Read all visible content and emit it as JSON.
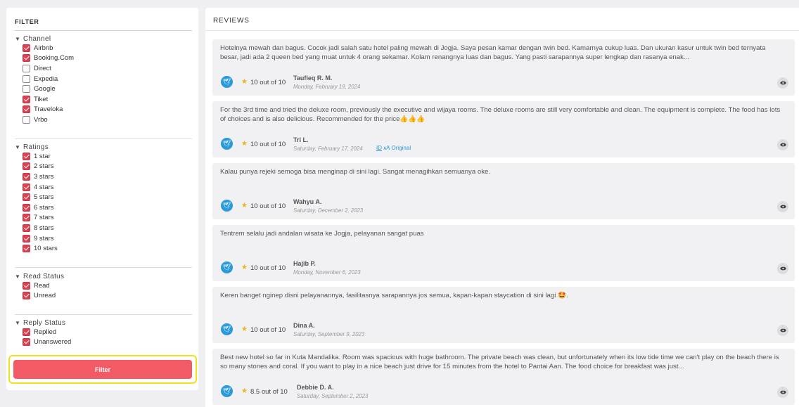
{
  "filter": {
    "title": "FILTER",
    "button_label": "Filter",
    "groups": [
      {
        "label": "Channel",
        "options": [
          {
            "label": "Airbnb",
            "checked": true
          },
          {
            "label": "Booking.Com",
            "checked": true
          },
          {
            "label": "Direct",
            "checked": false
          },
          {
            "label": "Expedia",
            "checked": false
          },
          {
            "label": "Google",
            "checked": false
          },
          {
            "label": "Tiket",
            "checked": true
          },
          {
            "label": "Traveloka",
            "checked": true
          },
          {
            "label": "Vrbo",
            "checked": false
          }
        ]
      },
      {
        "label": "Ratings",
        "options": [
          {
            "label": "1 star",
            "checked": true
          },
          {
            "label": "2 stars",
            "checked": true
          },
          {
            "label": "3 stars",
            "checked": true
          },
          {
            "label": "4 stars",
            "checked": true
          },
          {
            "label": "5 stars",
            "checked": true
          },
          {
            "label": "6 stars",
            "checked": true
          },
          {
            "label": "7 stars",
            "checked": true
          },
          {
            "label": "8 stars",
            "checked": true
          },
          {
            "label": "9 stars",
            "checked": true
          },
          {
            "label": "10 stars",
            "checked": true
          }
        ]
      },
      {
        "label": "Read Status",
        "options": [
          {
            "label": "Read",
            "checked": true
          },
          {
            "label": "Unread",
            "checked": true
          }
        ]
      },
      {
        "label": "Reply Status",
        "options": [
          {
            "label": "Replied",
            "checked": true
          },
          {
            "label": "Unanswered",
            "checked": true
          }
        ]
      }
    ]
  },
  "reviews": {
    "title": "REVIEWS",
    "items": [
      {
        "text": "Hotelnya mewah dan bagus. Cocok jadi salah satu hotel paling mewah di Jogja. Saya pesan kamar dengan twin bed. Kamarnya cukup luas. Dan ukuran kasur untuk twin bed ternyata besar, jadi ada 2 queen bed yang muat untuk 4 orang sekamar. Kolam renangnya luas dan bagus. Yang pasti sarapannya super lengkap dan rasanya enak...",
        "rating": "10 out of 10",
        "reviewer": "Taufieq R. M.",
        "date": "Monday, February 19, 2024",
        "source_icon": "bird-icon"
      },
      {
        "text": "For the 3rd time and tried the deluxe room, previously the executive and wijaya rooms. The deluxe rooms are still very comfortable and clean. The equipment is complete. The food has lots of choices and is also delicious. Recommended for the price👍👍👍",
        "rating": "10 out of 10",
        "reviewer": "Tri L.",
        "date": "Saturday, February 17, 2024",
        "lang_code": "ID",
        "lang_label": "Original",
        "source_icon": "bird-icon"
      },
      {
        "text": "Kalau punya rejeki semoga bisa menginap di sini lagi. Sangat menagihkan semuanya oke.",
        "rating": "10 out of 10",
        "reviewer": "Wahyu A.",
        "date": "Saturday, December 2, 2023",
        "source_icon": "bird-icon"
      },
      {
        "text": "Tentrem selalu jadi andalan wisata ke Jogja, pelayanan sangat puas",
        "rating": "10 out of 10",
        "reviewer": "Hajib P.",
        "date": "Monday, November 6, 2023",
        "source_icon": "bird-icon"
      },
      {
        "text": "Keren banget nginep disni pelayanannya, fasilitasnya sarapannya jos semua, kapan-kapan staycation di sini lagi 🤩.",
        "rating": "10 out of 10",
        "reviewer": "Dina A.",
        "date": "Saturday, September 9, 2023",
        "source_icon": "bird-icon"
      },
      {
        "text": "Best new hotel so far in Kuta Mandalika. Room was spacious with huge bathroom. The private beach was clean, but unfortunately when its low tide time we can't play on the beach there is so many stones and coral. If you want to play in a nice beach just drive for 15 minutes from the hotel to Pantai Aan. The food choice for breakfast was just...",
        "rating": "8.5 out of 10",
        "reviewer": "Debbie D. A.",
        "date": "Saturday, September 2, 2023",
        "source_icon": "bird-icon"
      }
    ]
  },
  "colors": {
    "accent": "#f25a66",
    "checkbox": "#d94454",
    "source_icon": "#2a9ad9",
    "star": "#f2b01e",
    "focus_outline": "#f0e020"
  }
}
